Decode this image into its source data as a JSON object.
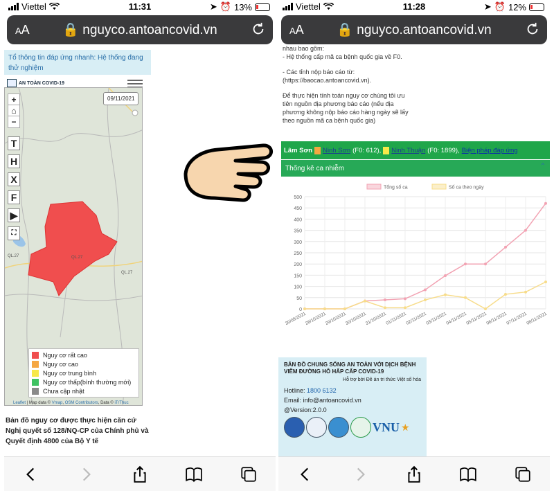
{
  "left": {
    "status": {
      "carrier": "Viettel",
      "time": "11:31",
      "battery": "13%"
    },
    "url": "nguyco.antoancovid.vn",
    "notice": "Tổ thông tin đáp ứng nhanh: Hệ thống đang thử nghiệm",
    "brand": "AN TOÀN COVID-19",
    "map": {
      "date": "09/11/2021",
      "zoom_in": "+",
      "zoom_out": "−",
      "tools": [
        "T",
        "H",
        "X",
        "F"
      ],
      "road_labels": [
        "QL.27",
        "QL.27",
        "QL.27"
      ],
      "legend": [
        {
          "label": "Nguy cơ rất cao",
          "color": "#f04e4e"
        },
        {
          "label": "Nguy cơ cao",
          "color": "#f5a742"
        },
        {
          "label": "Nguy cơ trung bình",
          "color": "#f7e84a"
        },
        {
          "label": "Nguy cơ thấp(bình thường mới)",
          "color": "#3fc262"
        },
        {
          "label": "Chưa cập nhật",
          "color": "#8a8a8a"
        }
      ],
      "attribution": {
        "leaflet": "Leaflet",
        "text": " | Map data © ",
        "vmap": "Vmap",
        "osm": "OSM Contributors",
        "data": ", Data © ",
        "owner": "iTrThuc"
      }
    },
    "caption": "Bản đồ nguy cơ được thực hiện căn cứ Nghị quyết số 128/NQ-CP của Chính phủ và Quyết định 4800 của Bộ Y tế"
  },
  "right": {
    "status": {
      "carrier": "Viettel",
      "time": "11:28",
      "battery": "12%"
    },
    "url": "nguyco.antoancovid.vn",
    "text_lines": [
      "nhau bao gồm:",
      "- Hệ thống cấp mã ca bệnh quốc gia về F0.",
      "",
      "- Các tỉnh nộp báo cáo từ:",
      "(https://baocao.antoancovid.vn).",
      "",
      "Để thực hiện tính toán nguy cơ chúng tôi ưu",
      "tiên nguồn địa phương báo cáo (nếu địa",
      "phương không nộp báo cáo hàng ngày sẽ lấy",
      "theo nguồn mã ca bệnh quốc gia)"
    ],
    "region_bar": {
      "place": "Lâm Sơn",
      "link1": "Ninh Sơn",
      "f1": "(F0: 612),",
      "link2": "Ninh Thuận",
      "f2": "(F0: 1899),",
      "link3": "Biện pháp đáp ứng",
      "color1": "#f5a742",
      "color2": "#f7e84a"
    },
    "section_title": "Thống kê ca nhiễm",
    "footer": {
      "title": "BẢN ĐỒ CHUNG SỐNG AN TOÀN VỚI DỊCH BỆNH VIÊM ĐƯỜNG HÔ HẤP CẤP COVID-19",
      "support": "Hỗ trợ bởi Đề án tri thức Việt số hóa",
      "hotline_label": "Hotline: ",
      "hotline": "1800 6132",
      "email": "Email: info@antoancovid.vn",
      "version": "@Version:2.0.0",
      "vnu": "VNU"
    }
  },
  "chart_data": {
    "type": "line",
    "categories": [
      "30/09/2021",
      "28/10/2021",
      "29/10/2021",
      "30/10/2021",
      "31/10/2021",
      "01/11/2021",
      "02/11/2021",
      "03/11/2021",
      "04/11/2021",
      "05/11/2021",
      "06/11/2021",
      "07/11/2021",
      "08/11/2021"
    ],
    "series": [
      {
        "name": "Tổng số ca",
        "color": "#f2a3b3",
        "values": [
          0,
          0,
          0,
          35,
          40,
          45,
          85,
          148,
          200,
          200,
          275,
          350,
          470
        ]
      },
      {
        "name": "Số ca theo ngày",
        "color": "#f7dc8a",
        "values": [
          0,
          0,
          0,
          35,
          5,
          5,
          40,
          63,
          50,
          0,
          65,
          75,
          120
        ]
      }
    ],
    "ylim": [
      0,
      500
    ],
    "yticks": [
      0,
      50,
      100,
      150,
      200,
      250,
      300,
      350,
      400,
      450,
      500
    ],
    "grid": true,
    "legend": "top"
  }
}
